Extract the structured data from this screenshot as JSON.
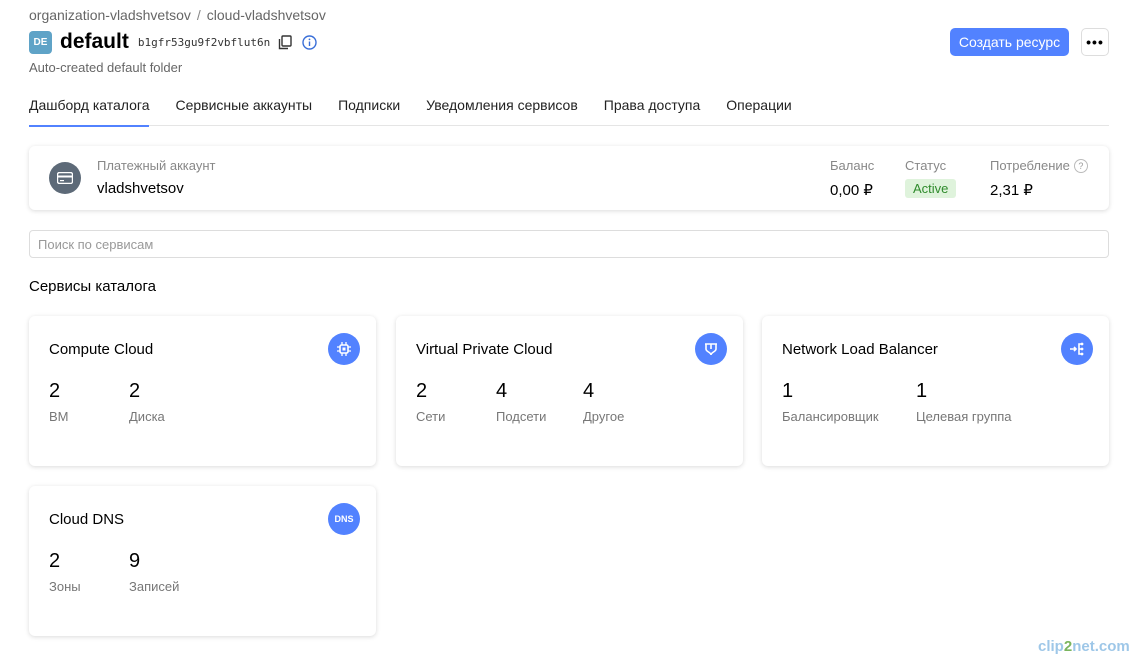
{
  "breadcrumb": {
    "organization": "organization-vladshvetsov",
    "separator": "/",
    "cloud": "cloud-vladshvetsov"
  },
  "header": {
    "avatar_initials": "DE",
    "title": "default",
    "folder_id": "b1gfr53gu9f2vbflut6n",
    "subtitle": "Auto-created default folder",
    "create_button": "Создать ресурс",
    "more_button": "•••"
  },
  "tabs": [
    {
      "label": "Дашборд каталога",
      "active": true
    },
    {
      "label": "Сервисные аккаунты",
      "active": false
    },
    {
      "label": "Подписки",
      "active": false
    },
    {
      "label": "Уведомления сервисов",
      "active": false
    },
    {
      "label": "Права доступа",
      "active": false
    },
    {
      "label": "Операции",
      "active": false
    }
  ],
  "billing": {
    "account_label": "Платежный аккаунт",
    "account_name": "vladshvetsov",
    "balance_label": "Баланс",
    "balance_value": "0,00 ₽",
    "status_label": "Статус",
    "status_value": "Active",
    "consumption_label": "Потребление",
    "consumption_help": "?",
    "consumption_value": "2,31 ₽"
  },
  "search": {
    "placeholder": "Поиск по сервисам"
  },
  "section_title": "Сервисы каталога",
  "services": {
    "compute": {
      "title": "Compute Cloud",
      "icon": "chip-icon",
      "stats": [
        {
          "value": "2",
          "label": "ВМ"
        },
        {
          "value": "2",
          "label": "Диска"
        }
      ]
    },
    "vpc": {
      "title": "Virtual Private Cloud",
      "icon": "network-icon",
      "stats": [
        {
          "value": "2",
          "label": "Сети"
        },
        {
          "value": "4",
          "label": "Подсети"
        },
        {
          "value": "4",
          "label": "Другое"
        }
      ]
    },
    "nlb": {
      "title": "Network Load Balancer",
      "icon": "balancer-icon",
      "stats": [
        {
          "value": "1",
          "label": "Балансировщик"
        },
        {
          "value": "1",
          "label": "Целевая группа"
        }
      ]
    },
    "dns": {
      "title": "Cloud DNS",
      "icon": "dns-icon",
      "icon_text": "DNS",
      "stats": [
        {
          "value": "2",
          "label": "Зоны"
        },
        {
          "value": "9",
          "label": "Записей"
        }
      ]
    }
  },
  "watermark": {
    "left": "clip",
    "mid": "2",
    "right": "net.com"
  },
  "colors": {
    "accent": "#5282ff",
    "status_bg": "#dff3dc",
    "status_text": "#2f8b2c",
    "avatar_bg": "#5fa3c7"
  }
}
